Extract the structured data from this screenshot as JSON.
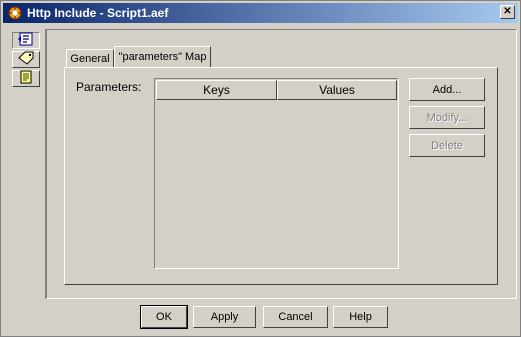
{
  "window": {
    "title": "Http Include - Script1.aef",
    "close_symbol": "✕",
    "app_icon": "script-app-icon"
  },
  "side_toolbar": {
    "items": [
      {
        "icon": "general-info-icon"
      },
      {
        "icon": "tag-icon"
      },
      {
        "icon": "document-icon"
      }
    ]
  },
  "tabs": [
    {
      "label": "General",
      "active": false
    },
    {
      "label": "\"parameters\" Map",
      "active": true
    }
  ],
  "parameters": {
    "label": "Parameters:",
    "columns": [
      "Keys",
      "Values"
    ],
    "rows": []
  },
  "side_buttons": {
    "add": "Add...",
    "modify": "Modify...",
    "delete": "Delete"
  },
  "footer_buttons": {
    "ok": "OK",
    "apply": "Apply",
    "cancel": "Cancel",
    "help": "Help"
  }
}
